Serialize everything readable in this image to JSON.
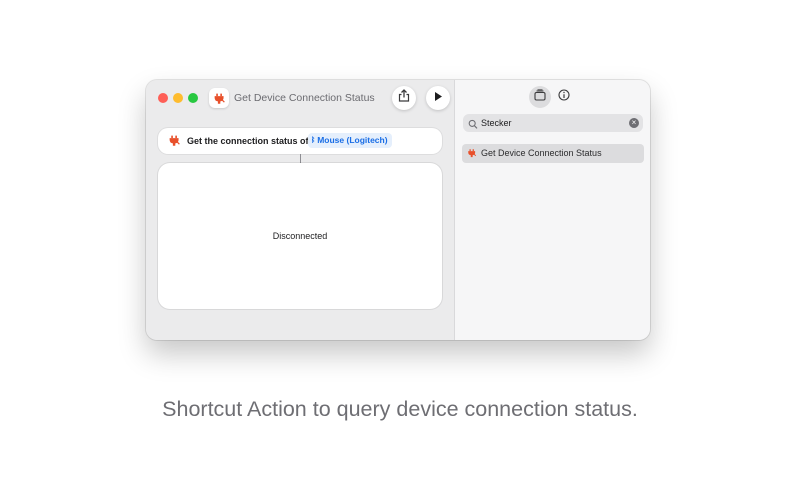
{
  "window": {
    "title": "Get Device Connection Status",
    "icon": "plug-icon"
  },
  "toolbar": {
    "share_icon": "share-icon",
    "run_icon": "play-icon"
  },
  "action": {
    "text": "Get the connection status of",
    "token_glyph": "ᛒ",
    "token_label": "Mouse (Logitech)"
  },
  "output": {
    "status": "Disconnected"
  },
  "library": {
    "tabs": [
      {
        "icon": "library-icon",
        "selected": true
      },
      {
        "icon": "info-icon",
        "selected": false
      }
    ],
    "search": {
      "value": "Stecker",
      "clear_glyph": "×"
    },
    "results": [
      {
        "label": "Get Device Connection Status",
        "icon": "plug-icon",
        "selected": true
      }
    ]
  },
  "caption": "Shortcut Action to query device connection status.",
  "colors": {
    "accent": "#1a6ee6",
    "plug": "#e8502b",
    "close": "#fe5f57",
    "minimize": "#febc2e",
    "zoom": "#28c840"
  }
}
